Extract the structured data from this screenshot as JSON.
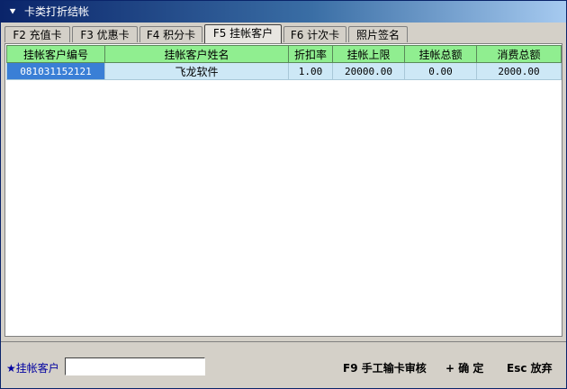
{
  "window": {
    "title": "卡类打折结帐"
  },
  "tabs": [
    {
      "label": "F2 充值卡"
    },
    {
      "label": "F3 优惠卡"
    },
    {
      "label": "F4 积分卡"
    },
    {
      "label": "F5 挂帐客户"
    },
    {
      "label": "F6 计次卡"
    },
    {
      "label": "照片签名"
    }
  ],
  "active_tab": "F5 挂帐客户",
  "table": {
    "columns": [
      "挂帐客户编号",
      "挂帐客户姓名",
      "折扣率",
      "挂帐上限",
      "挂帐总额",
      "消费总额"
    ],
    "rows": [
      [
        "081031152121",
        "飞龙软件",
        "1.00",
        "20000.00",
        "0.00",
        "2000.00"
      ]
    ]
  },
  "bottom": {
    "search_label": "★挂帐客户",
    "search_value": "",
    "f9_label": "F9 手工输卡审核",
    "ok_label": "+ 确 定",
    "esc_label": "Esc 放弃"
  },
  "colors": {
    "title_bar": "#0a246a",
    "header_bg": "#90ee90",
    "row_bg": "#cde8f6",
    "selected_cell": "#3a7fd6"
  }
}
